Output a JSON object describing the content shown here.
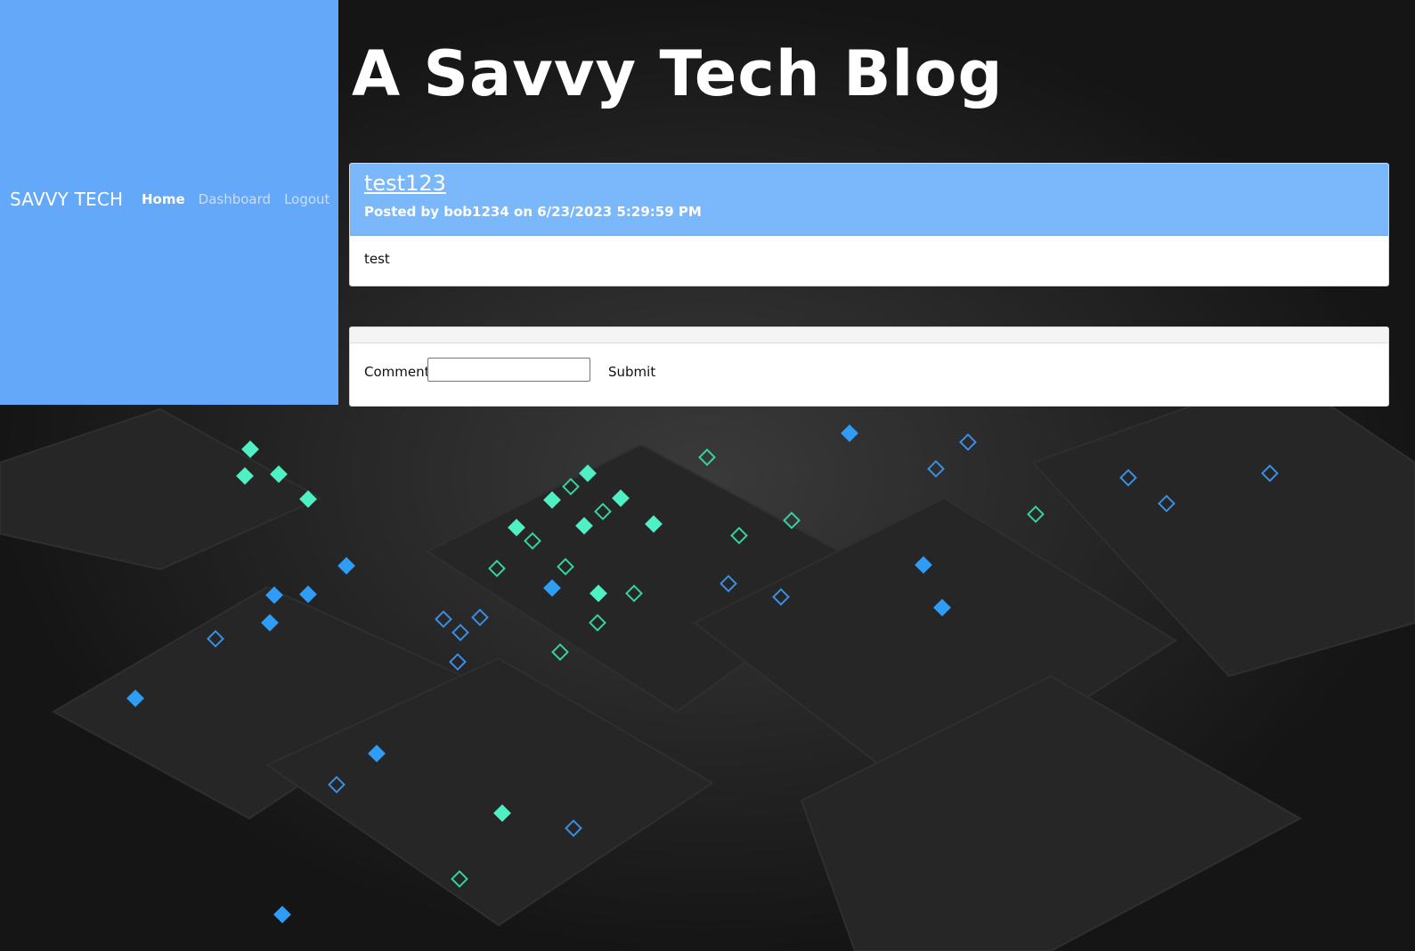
{
  "nav": {
    "brand": "SAVVY TECH",
    "links": [
      {
        "label": "Home"
      },
      {
        "label": "Dashboard"
      },
      {
        "label": "Logout"
      }
    ]
  },
  "header": {
    "title": "A Savvy Tech Blog"
  },
  "post": {
    "title": "test123",
    "meta": "Posted by bob1234 on 6/23/2023 5:29:59 PM",
    "body": "test"
  },
  "comment_form": {
    "label": "Comment",
    "value": "",
    "submit_label": "Submit"
  },
  "colors": {
    "nav_bg": "#64a8f9",
    "post_header_bg": "#7ab8fb",
    "background": "#1c1c1c"
  }
}
